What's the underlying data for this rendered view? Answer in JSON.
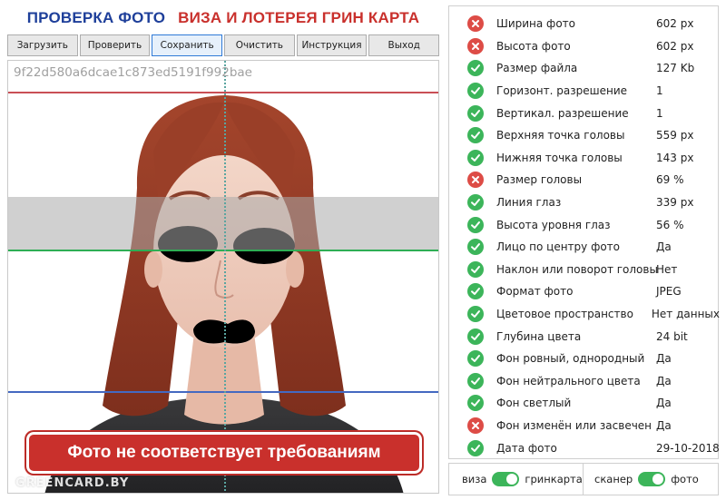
{
  "header": {
    "title_left": "ПРОВЕРКА ФОТО",
    "title_right": "ВИЗА И ЛОТЕРЕЯ ГРИН КАРТА"
  },
  "toolbar": {
    "load_label": "Загрузить",
    "check_label": "Проверить",
    "save_label": "Сохранить",
    "clear_label": "Очистить",
    "manual_label": "Инструкция",
    "exit_label": "Выход"
  },
  "photo": {
    "hash": "9f22d580a6dcae1c873ed5191f992bae",
    "warning": "Фото не соответствует требованиям",
    "watermark": "GREENCARD.BY"
  },
  "results": [
    {
      "label": "Ширина фото",
      "value": "602 px",
      "status": "fail"
    },
    {
      "label": "Высота фото",
      "value": "602 px",
      "status": "fail"
    },
    {
      "label": "Размер файла",
      "value": "127 Kb",
      "status": "ok"
    },
    {
      "label": "Горизонт. разрешение",
      "value": "1",
      "status": "ok"
    },
    {
      "label": "Вертикал. разрешение",
      "value": "1",
      "status": "ok"
    },
    {
      "label": "Верхняя точка головы",
      "value": "559 px",
      "status": "ok"
    },
    {
      "label": "Нижняя точка головы",
      "value": "143 px",
      "status": "ok"
    },
    {
      "label": "Размер головы",
      "value": "69 %",
      "status": "fail"
    },
    {
      "label": "Линия глаз",
      "value": "339 px",
      "status": "ok"
    },
    {
      "label": "Высота уровня глаз",
      "value": "56 %",
      "status": "ok"
    },
    {
      "label": "Лицо по центру фото",
      "value": "Да",
      "status": "ok"
    },
    {
      "label": "Наклон или поворот головы",
      "value": "Нет",
      "status": "ok"
    },
    {
      "label": "Формат фото",
      "value": "JPEG",
      "status": "ok"
    },
    {
      "label": "Цветовое пространство",
      "value": "Нет данных",
      "status": "ok"
    },
    {
      "label": "Глубина цвета",
      "value": "24 bit",
      "status": "ok"
    },
    {
      "label": "Фон ровный, однородный",
      "value": "Да",
      "status": "ok"
    },
    {
      "label": "Фон нейтрального цвета",
      "value": "Да",
      "status": "ok"
    },
    {
      "label": "Фон светлый",
      "value": "Да",
      "status": "ok"
    },
    {
      "label": "Фон изменён или засвечен",
      "value": "Да",
      "status": "fail"
    },
    {
      "label": "Дата фото",
      "value": "29-10-2018",
      "status": "ok"
    }
  ],
  "toggles": {
    "left_off": "виза",
    "left_on": "гринкарта",
    "right_off": "сканер",
    "right_on": "фото"
  },
  "colors": {
    "ok": "#3cb55a",
    "fail": "#dd4c46",
    "title_blue": "#1e3f9a",
    "title_red": "#c9302c"
  }
}
